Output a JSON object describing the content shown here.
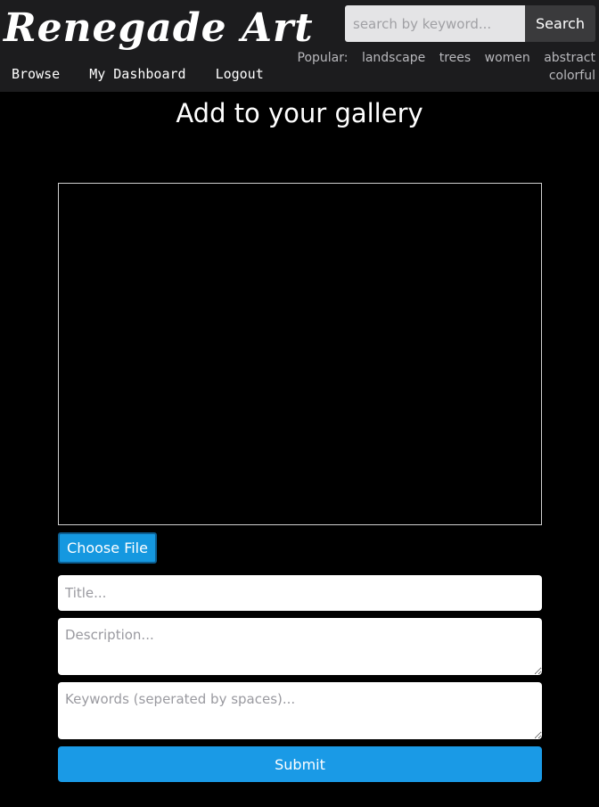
{
  "header": {
    "logo_text": "Renegade Art",
    "nav": {
      "browse": "Browse",
      "dashboard": "My Dashboard",
      "logout": "Logout"
    },
    "search": {
      "placeholder": "search by keyword...",
      "button_label": "Search"
    },
    "popular": {
      "label": "Popular:",
      "tags": [
        "landscape",
        "trees",
        "women",
        "abstract",
        "colorful"
      ]
    }
  },
  "main": {
    "title": "Add to your gallery",
    "choose_file_label": "Choose File",
    "title_placeholder": "Title...",
    "description_placeholder": "Description...",
    "keywords_placeholder": "Keywords (seperated by spaces)...",
    "submit_label": "Submit"
  },
  "colors": {
    "accent": "#1a9ae6",
    "header_bg": "#1c1c1e",
    "page_bg": "#000000"
  }
}
